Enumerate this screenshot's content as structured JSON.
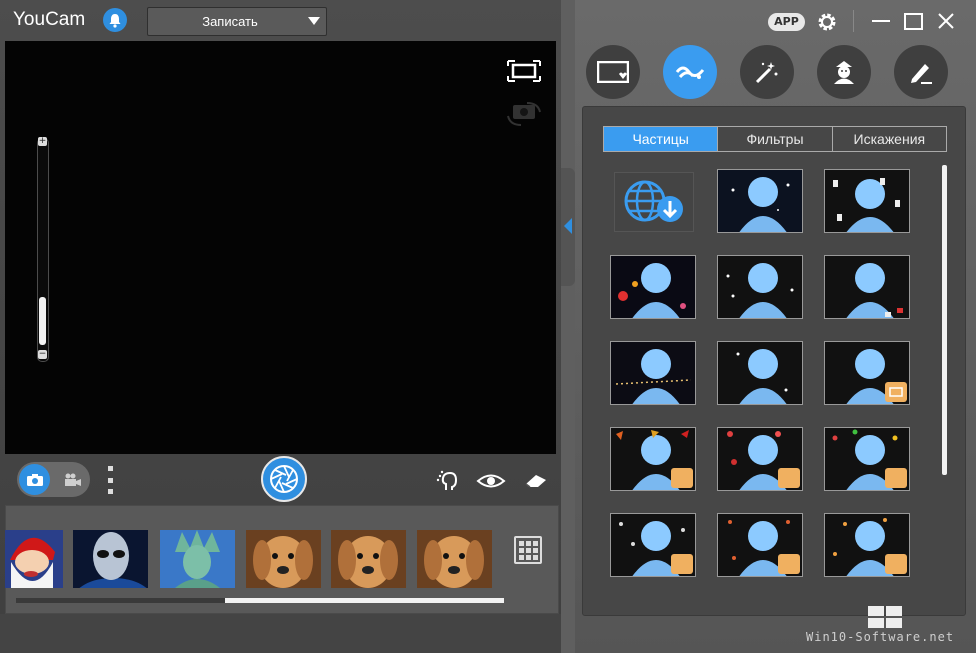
{
  "app": {
    "title": "YouCam",
    "app_badge": "APP"
  },
  "header": {
    "record_mode": "Записать"
  },
  "effects": {
    "tabs": [
      {
        "label": "Частицы",
        "active": true
      },
      {
        "label": "Фильтры",
        "active": false
      },
      {
        "label": "Искажения",
        "active": false
      }
    ]
  },
  "zoom": {
    "plus": "+",
    "minus": "−",
    "level": 0.22
  },
  "watermark": {
    "text": "Win10-Software.net"
  },
  "colors": {
    "accent": "#3a9cf0",
    "preview_bg": "#040404",
    "panel_bg": "#474747"
  },
  "icons": {
    "bell": "bell-icon",
    "fullscreen": "fullscreen-icon",
    "camera_switch": "camera-switch-icon",
    "photo": "camera-icon",
    "video": "video-camera-icon",
    "shutter": "shutter-icon",
    "face": "face-tracking-icon",
    "eye": "eye-icon",
    "eraser": "eraser-icon",
    "grid": "grid-icon",
    "frame": "frame-icon",
    "particles": "particles-icon",
    "magic": "magic-wand-icon",
    "avatar": "avatar-icon",
    "draw": "draw-icon"
  }
}
